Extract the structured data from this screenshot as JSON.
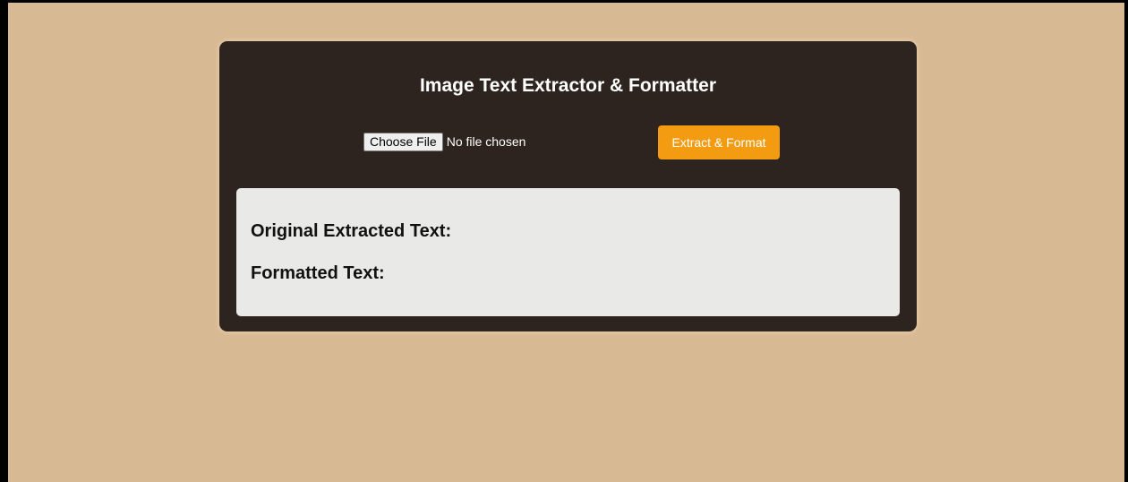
{
  "app": {
    "title": "Image Text Extractor & Formatter"
  },
  "file_input": {
    "button_label": "Choose File",
    "status": "No file chosen"
  },
  "actions": {
    "extract_label": "Extract & Format"
  },
  "results": {
    "original_heading": "Original Extracted Text:",
    "formatted_heading": "Formatted Text:"
  },
  "colors": {
    "background": "#d7ba94",
    "card": "#2d241f",
    "accent": "#f39c12",
    "results_panel": "#e9e9e7"
  }
}
